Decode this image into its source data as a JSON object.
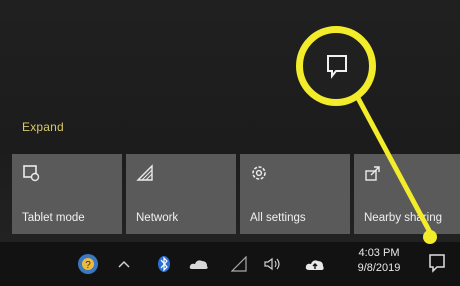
{
  "action_center": {
    "expand_label": "Expand",
    "tiles": [
      {
        "label": "Tablet mode",
        "icon": "tablet-mode-icon"
      },
      {
        "label": "Network",
        "icon": "network-icon"
      },
      {
        "label": "All settings",
        "icon": "settings-gear-icon"
      },
      {
        "label": "Nearby sharing",
        "icon": "nearby-sharing-icon"
      }
    ]
  },
  "taskbar": {
    "icons": [
      "help-icon",
      "chevron-up-icon",
      "bluetooth-icon",
      "onedrive-icon",
      "network-icon",
      "volume-icon",
      "cloud-upload-icon"
    ],
    "time": "4:03 PM",
    "date": "9/8/2019",
    "notification_icon": "action-center-icon"
  },
  "colors": {
    "highlight": "#f2ec2a",
    "tile": "#5a5a5a",
    "expand_text": "#d8c86a"
  }
}
